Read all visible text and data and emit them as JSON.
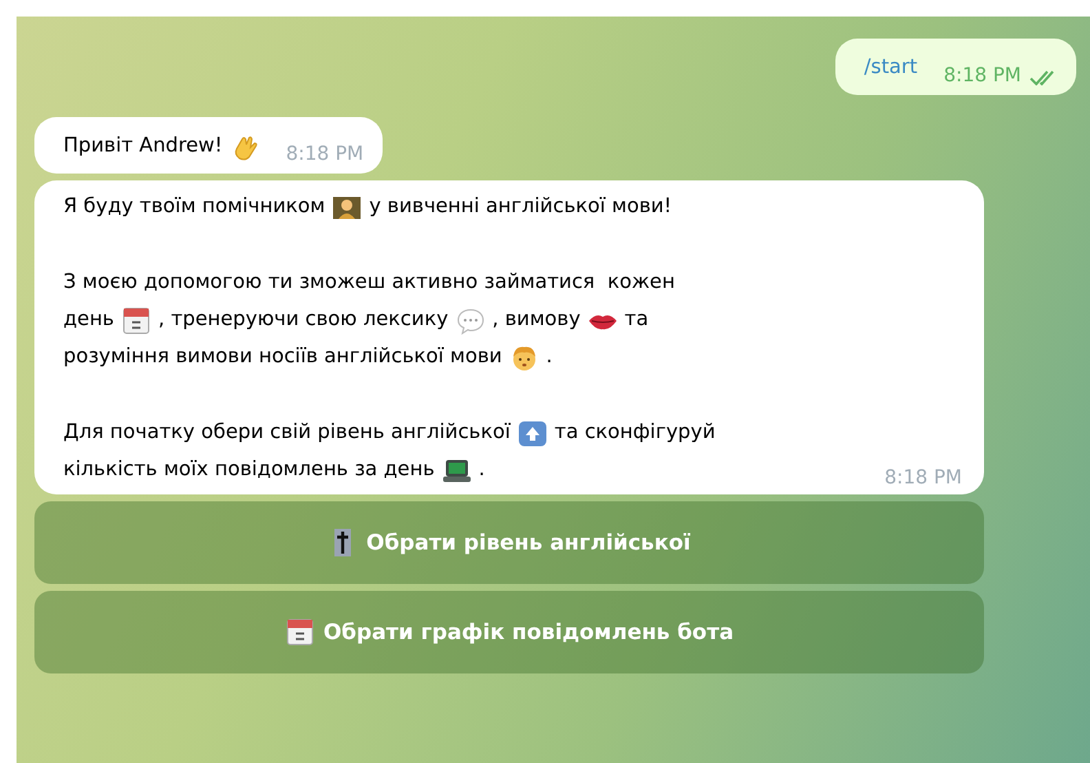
{
  "messages": [
    {
      "kind": "outgoing",
      "read": true,
      "time": "8:18 PM",
      "paragraphs": [
        [
          [
            {
              "kind": "command",
              "text": "/start"
            }
          ]
        ]
      ]
    },
    {
      "kind": "incoming",
      "time": "8:18 PM",
      "paragraphs": [
        [
          [
            {
              "kind": "text",
              "text": "Привіт Andrew!"
            },
            {
              "kind": "wave"
            }
          ]
        ]
      ]
    },
    {
      "kind": "incoming",
      "time": "8:18 PM",
      "paragraphs": [
        [
          [
            {
              "kind": "text",
              "text": "Я буду твоїм помічником"
            },
            {
              "kind": "teacher"
            },
            {
              "kind": "text",
              "text": "у вивченні англійської мови!"
            }
          ]
        ],
        [
          [
            {
              "kind": "text",
              "text": "З моєю допомогою ти зможеш активно займатися  кожен"
            }
          ],
          [
            {
              "kind": "text",
              "text": "день"
            },
            {
              "kind": "calendar"
            },
            {
              "kind": "text",
              "text": ", тренеруючи свою лексику"
            },
            {
              "kind": "speech"
            },
            {
              "kind": "text",
              "text": ", вимову"
            },
            {
              "kind": "lips"
            },
            {
              "kind": "text",
              "text": "та"
            }
          ],
          [
            {
              "kind": "text",
              "text": "розуміння вимови носіїв англійської мови"
            },
            {
              "kind": "face"
            },
            {
              "kind": "text",
              "text": "."
            }
          ]
        ],
        [
          [
            {
              "kind": "text",
              "text": "Для початку обери свій рівень англійської"
            },
            {
              "kind": "up"
            },
            {
              "kind": "text",
              "text": "та сконфігуруй"
            }
          ],
          [
            {
              "kind": "text",
              "text": "кількість моїх повідомлень за день"
            },
            {
              "kind": "laptop"
            },
            {
              "kind": "text",
              "text": "."
            }
          ]
        ]
      ]
    }
  ],
  "buttons": [
    {
      "label": "Обрати рівень англійської"
    },
    {
      "label": "Обрати графік повідомлень бота"
    }
  ]
}
